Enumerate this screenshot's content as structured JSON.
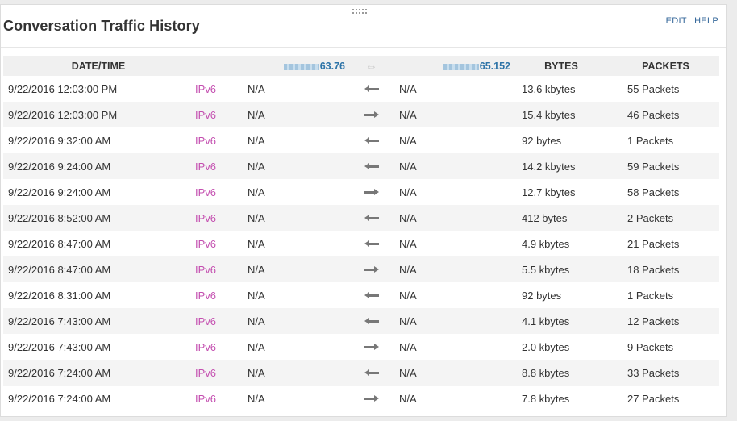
{
  "panel": {
    "title": "Conversation Traffic History",
    "edit_label": "EDIT",
    "help_label": "HELP"
  },
  "columns": {
    "datetime": "DATE/TIME",
    "src_ip_suffix": "63.76",
    "direction_glyph": "⇔",
    "dst_ip_suffix": "65.152",
    "bytes": "BYTES",
    "packets": "PACKETS"
  },
  "rows": [
    {
      "datetime": "9/22/2016 12:03:00 PM",
      "protocol": "IPv6",
      "src": "N/A",
      "direction": "left",
      "dst": "N/A",
      "bytes": "13.6 kbytes",
      "packets": "55 Packets"
    },
    {
      "datetime": "9/22/2016 12:03:00 PM",
      "protocol": "IPv6",
      "src": "N/A",
      "direction": "right",
      "dst": "N/A",
      "bytes": "15.4 kbytes",
      "packets": "46 Packets"
    },
    {
      "datetime": "9/22/2016 9:32:00 AM",
      "protocol": "IPv6",
      "src": "N/A",
      "direction": "left",
      "dst": "N/A",
      "bytes": "92 bytes",
      "packets": "1 Packets"
    },
    {
      "datetime": "9/22/2016 9:24:00 AM",
      "protocol": "IPv6",
      "src": "N/A",
      "direction": "left",
      "dst": "N/A",
      "bytes": "14.2 kbytes",
      "packets": "59 Packets"
    },
    {
      "datetime": "9/22/2016 9:24:00 AM",
      "protocol": "IPv6",
      "src": "N/A",
      "direction": "right",
      "dst": "N/A",
      "bytes": "12.7 kbytes",
      "packets": "58 Packets"
    },
    {
      "datetime": "9/22/2016 8:52:00 AM",
      "protocol": "IPv6",
      "src": "N/A",
      "direction": "left",
      "dst": "N/A",
      "bytes": "412 bytes",
      "packets": "2 Packets"
    },
    {
      "datetime": "9/22/2016 8:47:00 AM",
      "protocol": "IPv6",
      "src": "N/A",
      "direction": "left",
      "dst": "N/A",
      "bytes": "4.9 kbytes",
      "packets": "21 Packets"
    },
    {
      "datetime": "9/22/2016 8:47:00 AM",
      "protocol": "IPv6",
      "src": "N/A",
      "direction": "right",
      "dst": "N/A",
      "bytes": "5.5 kbytes",
      "packets": "18 Packets"
    },
    {
      "datetime": "9/22/2016 8:31:00 AM",
      "protocol": "IPv6",
      "src": "N/A",
      "direction": "left",
      "dst": "N/A",
      "bytes": "92 bytes",
      "packets": "1 Packets"
    },
    {
      "datetime": "9/22/2016 7:43:00 AM",
      "protocol": "IPv6",
      "src": "N/A",
      "direction": "left",
      "dst": "N/A",
      "bytes": "4.1 kbytes",
      "packets": "12 Packets"
    },
    {
      "datetime": "9/22/2016 7:43:00 AM",
      "protocol": "IPv6",
      "src": "N/A",
      "direction": "right",
      "dst": "N/A",
      "bytes": "2.0 kbytes",
      "packets": "9 Packets"
    },
    {
      "datetime": "9/22/2016 7:24:00 AM",
      "protocol": "IPv6",
      "src": "N/A",
      "direction": "left",
      "dst": "N/A",
      "bytes": "8.8 kbytes",
      "packets": "33 Packets"
    },
    {
      "datetime": "9/22/2016 7:24:00 AM",
      "protocol": "IPv6",
      "src": "N/A",
      "direction": "right",
      "dst": "N/A",
      "bytes": "7.8 kbytes",
      "packets": "27 Packets"
    }
  ],
  "colors": {
    "link": "#336699",
    "ip_header": "#2e74a8",
    "protocol": "#c44fb0",
    "stripe": "#f4f4f4",
    "arrow": "#777777"
  }
}
